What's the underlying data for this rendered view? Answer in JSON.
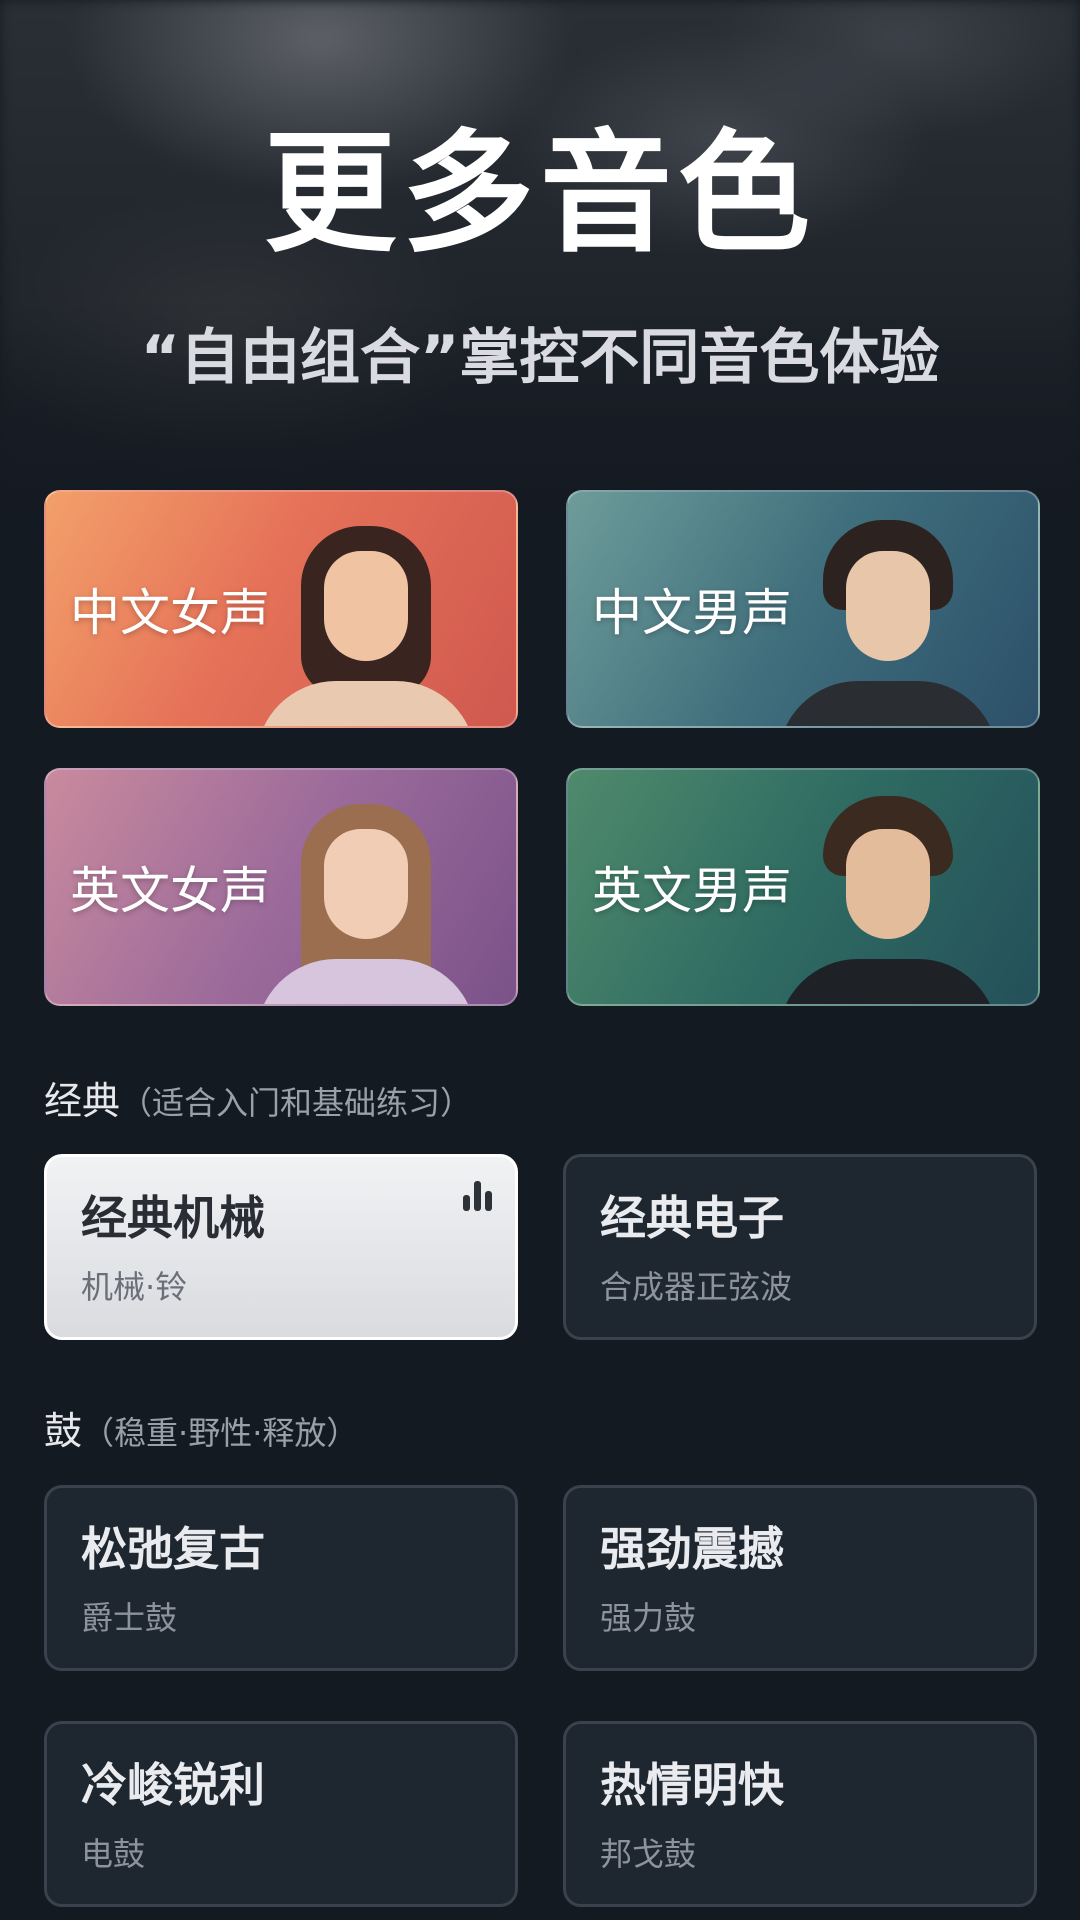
{
  "header": {
    "title": "更多音色",
    "subtitle": "“自由组合”掌控不同音色体验"
  },
  "voices": [
    {
      "label": "中文女声"
    },
    {
      "label": "中文男声"
    },
    {
      "label": "英文女声"
    },
    {
      "label": "英文男声"
    }
  ],
  "sections": [
    {
      "title": "经典",
      "note": "（适合入门和基础练习）",
      "tones": [
        {
          "name": "经典机械",
          "sub": "机械·铃",
          "selected": true
        },
        {
          "name": "经典电子",
          "sub": "合成器正弦波",
          "selected": false
        }
      ]
    },
    {
      "title": "鼓",
      "note": "（稳重·野性·释放）",
      "tones": [
        {
          "name": "松弛复古",
          "sub": "爵士鼓"
        },
        {
          "name": "强劲震撼",
          "sub": "强力鼓"
        },
        {
          "name": "冷峻锐利",
          "sub": "电鼓"
        },
        {
          "name": "热情明快",
          "sub": "邦戈鼓"
        }
      ]
    }
  ],
  "icons": {
    "selected_indicator": "equalizer-bars-icon"
  },
  "colors": {
    "background": "#141a22",
    "card": "#1e262f",
    "card_border": "#39424d",
    "selected_card": "#e6e7ea"
  }
}
